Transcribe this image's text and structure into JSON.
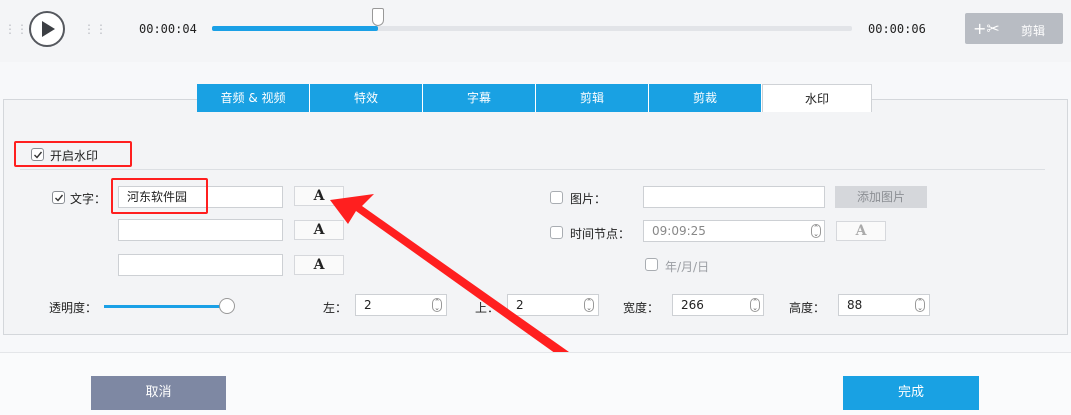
{
  "player": {
    "current_time": "00:00:04",
    "total_time": "00:00:06",
    "progress": 0.26,
    "cut_label": "剪辑"
  },
  "tabs": [
    {
      "label": "音频 & 视频",
      "active": false
    },
    {
      "label": "特效",
      "active": false
    },
    {
      "label": "字幕",
      "active": false
    },
    {
      "label": "剪辑",
      "active": false
    },
    {
      "label": "剪裁",
      "active": false
    },
    {
      "label": "水印",
      "active": true
    }
  ],
  "watermark": {
    "enable_label": "开启水印",
    "enabled": true,
    "text_label": "文字：",
    "text_checked": true,
    "text_values": [
      "河东软件园",
      "",
      ""
    ],
    "font_button": "A",
    "image_label": "图片：",
    "image_value": "",
    "add_image_label": "添加图片",
    "time_label": "时间节点：",
    "time_value": "09:09:25",
    "date_label": "年/月/日",
    "opacity_label": "透明度：",
    "opacity": 1.0,
    "left_label": "左：",
    "left_value": "2",
    "top_label": "上：",
    "top_value": "2",
    "width_label": "宽度：",
    "width_value": "266",
    "height_label": "高度：",
    "height_value": "88"
  },
  "footer": {
    "cancel_label": "取消",
    "done_label": "完成"
  },
  "colors": {
    "accent": "#19a1e3",
    "annotation": "#ff1f1f",
    "cancel": "#7e88a3"
  }
}
